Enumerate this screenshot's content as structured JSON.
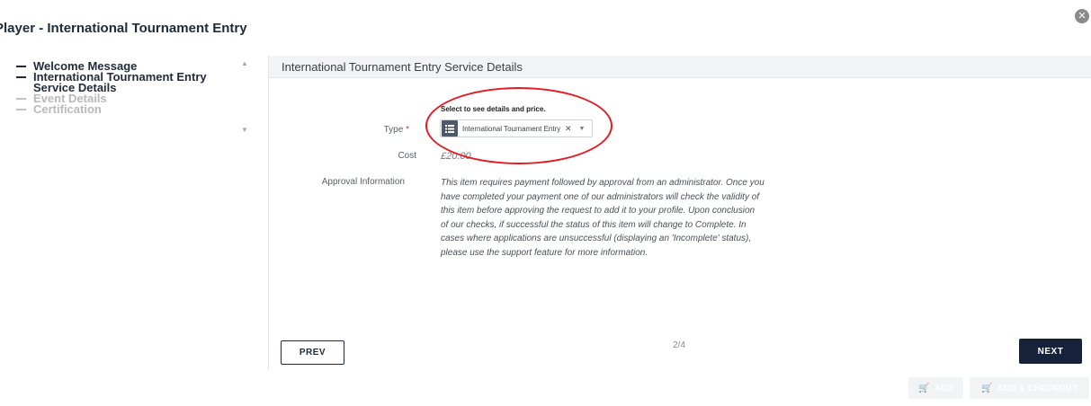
{
  "modal": {
    "title": "Player - International Tournament Entry",
    "close_glyph": "✕"
  },
  "steps": [
    {
      "label": "Welcome Message",
      "state": "completed"
    },
    {
      "label": "International Tournament Entry Service Details",
      "state": "current"
    },
    {
      "label": "Event Details",
      "state": "upcoming"
    },
    {
      "label": "Certification",
      "state": "upcoming"
    }
  ],
  "scroll": {
    "up_glyph": "▲",
    "down_glyph": "▼"
  },
  "section": {
    "title": "International Tournament Entry Service Details"
  },
  "form": {
    "hint": "Select to see details and price.",
    "type_label": "Type",
    "required_mark": "*",
    "type_value": "International Tournament Entry",
    "type_icon": "list-icon",
    "clear_glyph": "✕",
    "caret_glyph": "▼",
    "cost_label": "Cost",
    "cost_value": "£20.00",
    "approval_label": "Approval Information",
    "approval_text": "This item requires payment followed by approval from an administrator. Once you have completed your payment one of our administrators will check the validity of this item before approving the request to add it to your profile. Upon conclusion of our checks, if successful the status of this item will change to Complete. In cases where applications are unsuccessful (displaying an 'Incomplete' status), please use the support feature for more information."
  },
  "nav": {
    "prev_label": "PREV",
    "page_indicator": "2/4",
    "next_label": "NEXT"
  },
  "footer": {
    "add_label": "ADD",
    "add_checkout_label": "ADD & CHECKOUT",
    "cart_icon": "cart-icon"
  },
  "colors": {
    "primary": "#16213a",
    "annotation": "#e31b23",
    "header_bg": "#f1f3f5"
  }
}
